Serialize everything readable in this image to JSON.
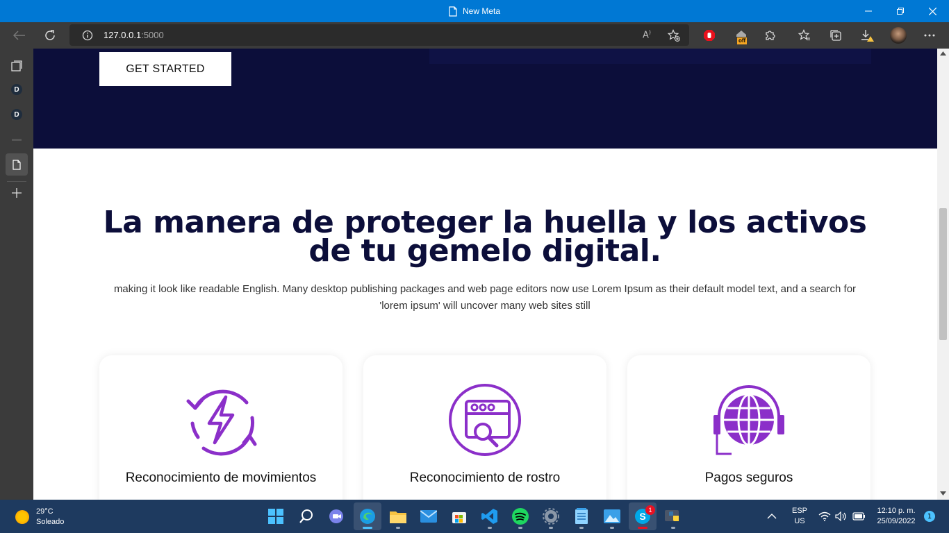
{
  "window": {
    "title": "New Meta"
  },
  "address_bar": {
    "host": "127.0.0.1",
    "port": ":5000"
  },
  "sidebar": {
    "items": [
      {
        "badge": "D"
      },
      {
        "badge": "D"
      }
    ]
  },
  "hero": {
    "cta_label": "GET STARTED"
  },
  "section": {
    "headline": "La manera de proteger la huella y los activos de tu gemelo digital.",
    "subtext": "making it look like readable English. Many desktop publishing packages and web page editors now use Lorem Ipsum as their default model text, and a search for 'lorem ipsum' will uncover many web sites still"
  },
  "cards": [
    {
      "title": "Reconocimiento de movimientos",
      "icon": "energy-refresh-icon"
    },
    {
      "title": "Reconocimiento de rostro",
      "icon": "browser-search-icon"
    },
    {
      "title": "Pagos seguros",
      "icon": "globe-headset-icon"
    }
  ],
  "colors": {
    "accent": "#8b2fc9",
    "hero_bg": "#0c0e3a",
    "titlebar": "#0078d4",
    "taskbar": "#1e3a5f"
  },
  "taskbar": {
    "weather_temp": "29°C",
    "weather_desc": "Soleado",
    "lang": "ESP",
    "layout": "US",
    "time": "12:10 p. m.",
    "date": "25/09/2022",
    "skype_badge": "1",
    "notifications": "1",
    "ext_badge": "off"
  }
}
